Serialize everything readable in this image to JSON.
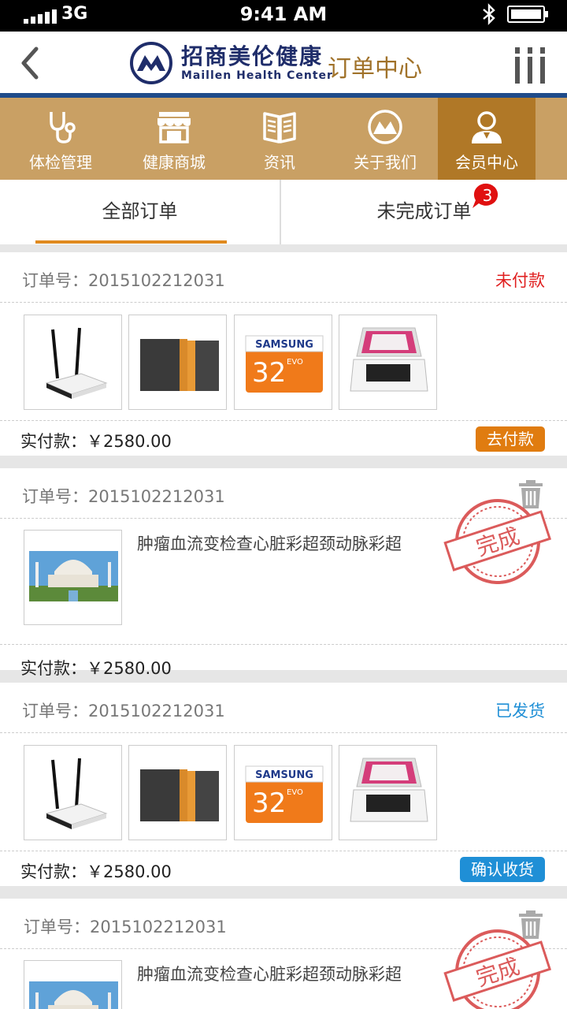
{
  "statusbar": {
    "network": "3G",
    "time": "9:41 AM"
  },
  "header": {
    "logo_cn": "招商美伦健康",
    "logo_en": "Maillen Health Center",
    "title": "订单中心"
  },
  "nav": [
    {
      "label": "体检管理",
      "icon": "stethoscope-icon"
    },
    {
      "label": "健康商城",
      "icon": "shop-icon"
    },
    {
      "label": "资讯",
      "icon": "book-icon"
    },
    {
      "label": "关于我们",
      "icon": "logo-icon"
    },
    {
      "label": "会员中心",
      "icon": "user-icon",
      "active": true
    }
  ],
  "tabs": {
    "all": "全部订单",
    "incomplete": "未完成订单",
    "badge": "3"
  },
  "orders": [
    {
      "order_no": "订单号：2015102212031",
      "status": "未付款",
      "paid": "实付款：￥2580.00",
      "action": "去付款"
    },
    {
      "order_no": "订单号：2015102212031",
      "item_name": "肿瘤血流变检查心脏彩超颈动脉彩超",
      "paid": "实付款：￥2580.00",
      "stamp": "完成"
    },
    {
      "order_no": "订单号：2015102212031",
      "status": "已发货",
      "paid": "实付款：￥2580.00",
      "action": "确认收货"
    },
    {
      "order_no": "订单号：2015102212031",
      "item_name": "肿瘤血流变检查心脏彩超颈动脉彩超",
      "stamp": "完成"
    }
  ],
  "product_labels": {
    "sd_brand": "SAMSUNG",
    "sd_size": "32",
    "sd_evo": "EVO"
  },
  "colors": {
    "nav_bg": "#c9a064",
    "nav_active": "#b07827",
    "accent_orange": "#e07c10",
    "status_red": "#e02020",
    "status_blue": "#1f8fd6"
  }
}
